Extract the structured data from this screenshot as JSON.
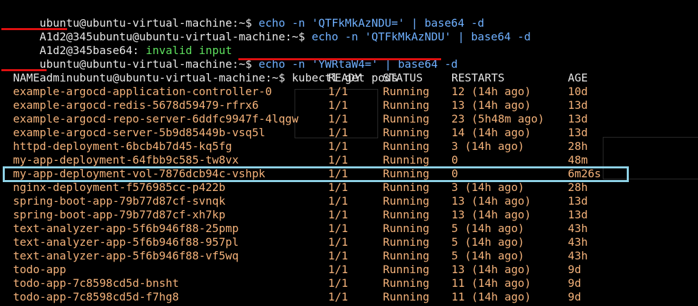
{
  "terminal": {
    "lines": [
      {
        "prefix": "",
        "prompt": "ubuntu@ubuntu-virtual-machine:~$ ",
        "command": "echo -n 'QTFkMkAzNDU=' | base64 -d"
      },
      {
        "prefix": "A1d2@345",
        "prompt": "ubuntu@ubuntu-virtual-machine:~$ ",
        "command": "echo -n 'QTFkMkAzNDU' | base64 -d"
      },
      {
        "prefix": "A1d2@345base64: ",
        "prompt": "",
        "command": "invalid input"
      },
      {
        "prefix": "",
        "prompt": "ubuntu@ubuntu-virtual-machine:~$ ",
        "command": "echo -n 'YWRtaW4=' | base64 -d"
      },
      {
        "prefix": "admin",
        "prompt": "ubuntu@ubuntu-virtual-machine:~$ ",
        "command": "kubectl get pods"
      }
    ],
    "table_headers": {
      "name": "NAME",
      "ready": "READY",
      "status": "STATUS",
      "restarts": "RESTARTS",
      "age": "AGE"
    },
    "pods": [
      {
        "name": "example-argocd-application-controller-0",
        "ready": "1/1",
        "status": "Running",
        "restarts": "12 (14h ago)",
        "age": "10d"
      },
      {
        "name": "example-argocd-redis-5678d59479-rfrx6",
        "ready": "1/1",
        "status": "Running",
        "restarts": "13 (14h ago)",
        "age": "13d"
      },
      {
        "name": "example-argocd-repo-server-6ddfc9947f-4lqgw",
        "ready": "1/1",
        "status": "Running",
        "restarts": "23 (5h48m ago)",
        "age": "13d"
      },
      {
        "name": "example-argocd-server-5b9d85449b-vsq5l",
        "ready": "1/1",
        "status": "Running",
        "restarts": "14 (14h ago)",
        "age": "13d"
      },
      {
        "name": "httpd-deployment-6bcb4b7d45-kq5fg",
        "ready": "1/1",
        "status": "Running",
        "restarts": "3 (14h ago)",
        "age": "28h"
      },
      {
        "name": "my-app-deployment-64fbb9c585-tw8vx",
        "ready": "1/1",
        "status": "Running",
        "restarts": "0",
        "age": "48m"
      },
      {
        "name": "my-app-deployment-vol-7876dcb94c-vshpk",
        "ready": "1/1",
        "status": "Running",
        "restarts": "0",
        "age": "6m26s"
      },
      {
        "name": "nginx-deployment-f576985cc-p422b",
        "ready": "1/1",
        "status": "Running",
        "restarts": "3 (14h ago)",
        "age": "28h"
      },
      {
        "name": "spring-boot-app-79b77d87cf-svnqk",
        "ready": "1/1",
        "status": "Running",
        "restarts": "13 (14h ago)",
        "age": "13d"
      },
      {
        "name": "spring-boot-app-79b77d87cf-xh7kp",
        "ready": "1/1",
        "status": "Running",
        "restarts": "13 (14h ago)",
        "age": "13d"
      },
      {
        "name": "text-analyzer-app-5f6b946f88-25pmp",
        "ready": "1/1",
        "status": "Running",
        "restarts": "5 (14h ago)",
        "age": "43h"
      },
      {
        "name": "text-analyzer-app-5f6b946f88-957pl",
        "ready": "1/1",
        "status": "Running",
        "restarts": "5 (14h ago)",
        "age": "43h"
      },
      {
        "name": "text-analyzer-app-5f6b946f88-vf5wq",
        "ready": "1/1",
        "status": "Running",
        "restarts": "5 (14h ago)",
        "age": "43h"
      },
      {
        "name": "todo-app",
        "ready": "1/1",
        "status": "Running",
        "restarts": "13 (14h ago)",
        "age": "9d"
      },
      {
        "name": "todo-app-7c8598cd5d-bnsht",
        "ready": "1/1",
        "status": "Running",
        "restarts": "11 (14h ago)",
        "age": "9d"
      },
      {
        "name": "todo-app-7c8598cd5d-f7hg8",
        "ready": "1/1",
        "status": "Running",
        "restarts": "11 (14h ago)",
        "age": "9d"
      }
    ],
    "colors": {
      "background": "#000000",
      "text": "#e6e6e6",
      "command": "#6fb0ff",
      "ok_green": "#5ee05e",
      "pod_text": "#f4b27a",
      "annotation_red": "#e01010",
      "highlight_cyan": "#8fd3e8"
    }
  }
}
